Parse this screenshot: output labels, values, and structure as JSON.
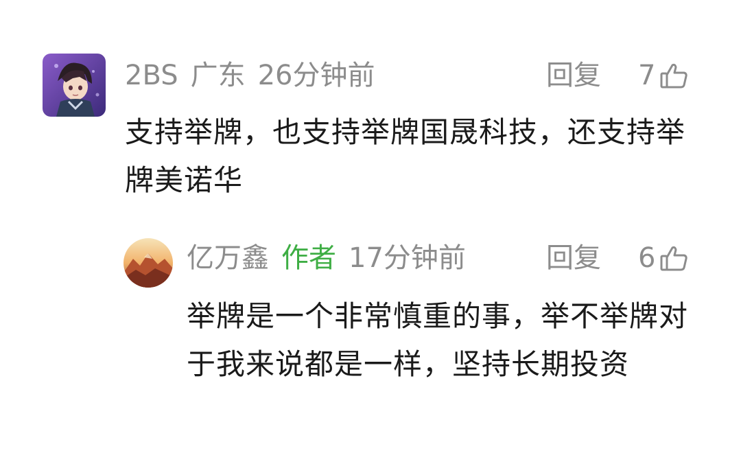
{
  "comments": [
    {
      "username": "2BS",
      "region": "广东",
      "time": "26分钟前",
      "reply_label": "回复",
      "likes": "7",
      "text": "支持举牌，也支持举牌国晟科技，还支持举牌美诺华"
    }
  ],
  "replies": [
    {
      "username": "亿万鑫",
      "author_badge": "作者",
      "time": "17分钟前",
      "reply_label": "回复",
      "likes": "6",
      "text": "举牌是一个非常慎重的事，举不举牌对于我来说都是一样，坚持长期投资"
    }
  ],
  "colors": {
    "meta_gray": "#8c8c8c",
    "author_green": "#3fae45",
    "body_text": "#1a1a1a"
  }
}
